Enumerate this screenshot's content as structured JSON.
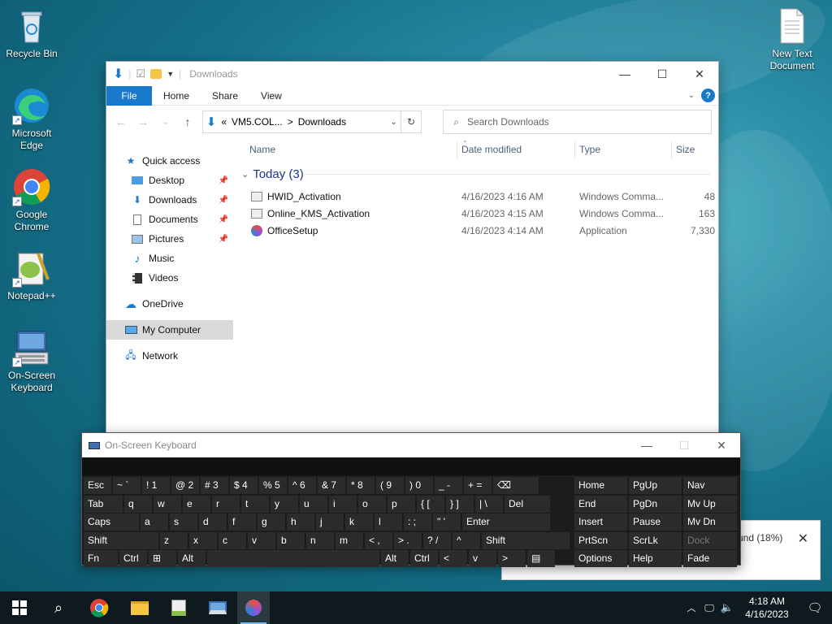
{
  "desktop": {
    "icons_left": [
      "Recycle Bin",
      "Microsoft Edge",
      "Google Chrome",
      "Notepad++",
      "On-Screen Keyboard"
    ],
    "icon_right": "New Text Document"
  },
  "explorer": {
    "title": "Downloads",
    "ribbon_tabs": [
      "File",
      "Home",
      "Share",
      "View"
    ],
    "address": {
      "prefix": "«",
      "part1": "VM5.COL...",
      "sep": ">",
      "part2": "Downloads"
    },
    "search_placeholder": "Search Downloads",
    "nav": {
      "quick_access": "Quick access",
      "items": [
        "Desktop",
        "Downloads",
        "Documents",
        "Pictures",
        "Music",
        "Videos"
      ],
      "onedrive": "OneDrive",
      "my_computer": "My Computer",
      "network": "Network"
    },
    "columns": {
      "name": "Name",
      "date": "Date modified",
      "type": "Type",
      "size": "Size"
    },
    "group": "Today (3)",
    "files": [
      {
        "name": "HWID_Activation",
        "date": "4/16/2023 4:16 AM",
        "type": "Windows Comma...",
        "size": "48"
      },
      {
        "name": "Online_KMS_Activation",
        "date": "4/16/2023 4:15 AM",
        "type": "Windows Comma...",
        "size": "163"
      },
      {
        "name": "OfficeSetup",
        "date": "4/16/2023 4:14 AM",
        "type": "Application",
        "size": "7,330"
      }
    ]
  },
  "osk": {
    "title": "On-Screen Keyboard",
    "row1": [
      "Esc",
      "~ `",
      "! 1",
      "@ 2",
      "# 3",
      "$ 4",
      "% 5",
      "^ 6",
      "& 7",
      "* 8",
      "( 9",
      ") 0",
      "_ -",
      "+ ="
    ],
    "row2": [
      "Tab",
      "q",
      "w",
      "e",
      "r",
      "t",
      "y",
      "u",
      "i",
      "o",
      "p",
      "{ [",
      "} ]",
      "| \\",
      "Del"
    ],
    "row3": [
      "Caps",
      "a",
      "s",
      "d",
      "f",
      "g",
      "h",
      "j",
      "k",
      "l",
      ": ;",
      "\" '",
      "Enter"
    ],
    "row4": [
      "Shift",
      "z",
      "x",
      "c",
      "v",
      "b",
      "n",
      "m",
      "< ,",
      "> .",
      "? /",
      "^",
      "Shift"
    ],
    "row5": [
      "Fn",
      "Ctrl",
      "⊞",
      "Alt",
      "",
      "Alt",
      "Ctrl",
      "<",
      "v",
      ">",
      "▤"
    ],
    "nav_keys": [
      [
        "Home",
        "PgUp",
        "Nav"
      ],
      [
        "End",
        "PgDn",
        "Mv Up"
      ],
      [
        "Insert",
        "Pause",
        "Mv Dn"
      ],
      [
        "PrtScn",
        "ScrLk",
        "Dock"
      ],
      [
        "Options",
        "Help",
        "Fade"
      ]
    ]
  },
  "notification": {
    "text": "und (18%)"
  },
  "taskbar": {
    "time": "4:18 AM",
    "date": "4/16/2023"
  }
}
